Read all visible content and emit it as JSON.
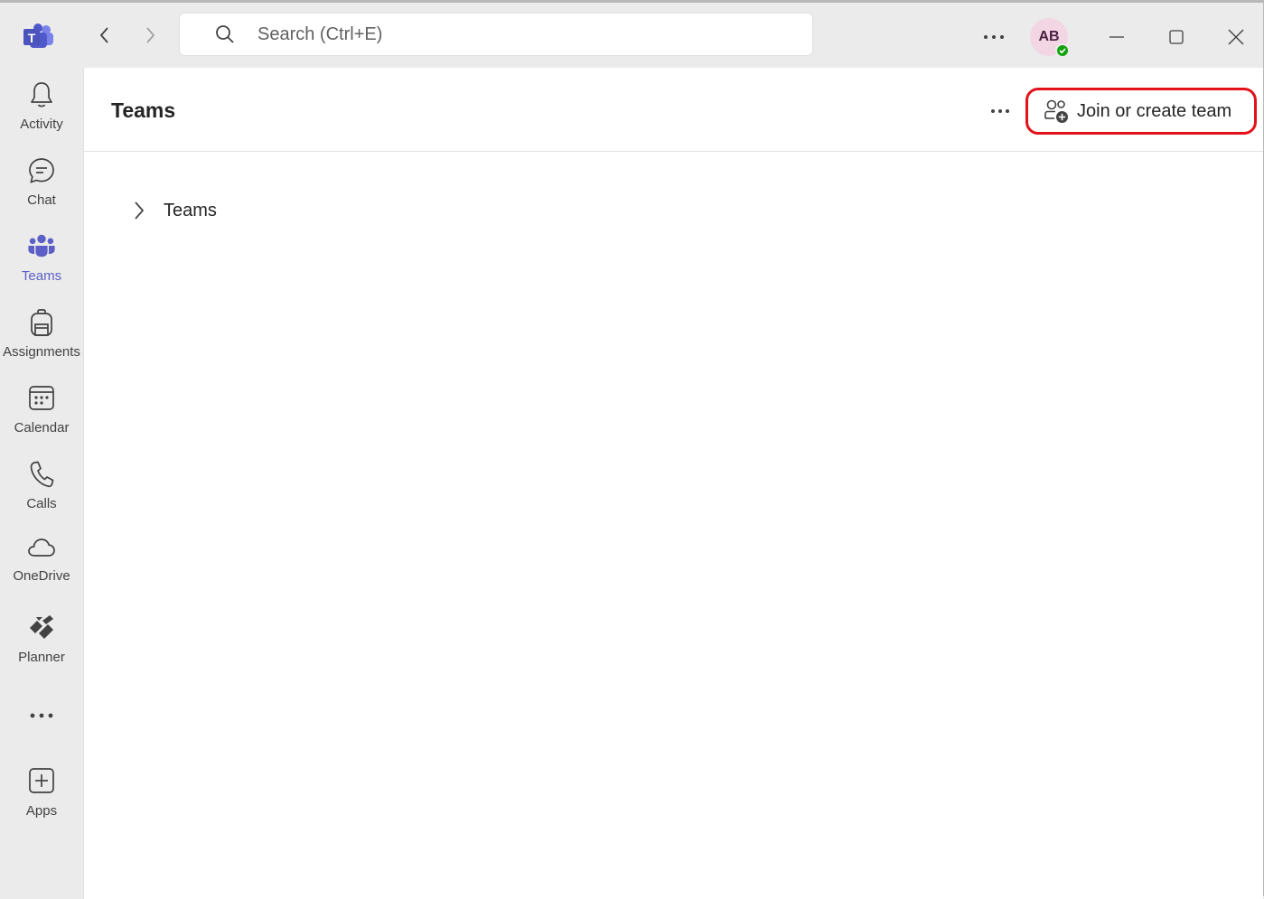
{
  "titlebar": {
    "search_placeholder": "Search (Ctrl+E)",
    "avatar_initials": "AB",
    "presence_color": "#13a10e"
  },
  "rail": {
    "items": [
      {
        "label": "Activity",
        "icon": "bell-icon"
      },
      {
        "label": "Chat",
        "icon": "chat-icon"
      },
      {
        "label": "Teams",
        "icon": "teams-icon",
        "active": true
      },
      {
        "label": "Assignments",
        "icon": "backpack-icon"
      },
      {
        "label": "Calendar",
        "icon": "calendar-icon"
      },
      {
        "label": "Calls",
        "icon": "phone-icon"
      },
      {
        "label": "OneDrive",
        "icon": "cloud-icon"
      },
      {
        "label": "Planner",
        "icon": "planner-icon"
      },
      {
        "label": "",
        "icon": "more-horizontal-icon"
      },
      {
        "label": "Apps",
        "icon": "add-app-icon"
      }
    ],
    "accent_color": "#5b5fc7"
  },
  "main": {
    "title": "Teams",
    "join_button_label": "Join or create team",
    "tree": [
      {
        "label": "Teams",
        "expanded": false
      }
    ],
    "highlight_color": "#e3121a"
  }
}
